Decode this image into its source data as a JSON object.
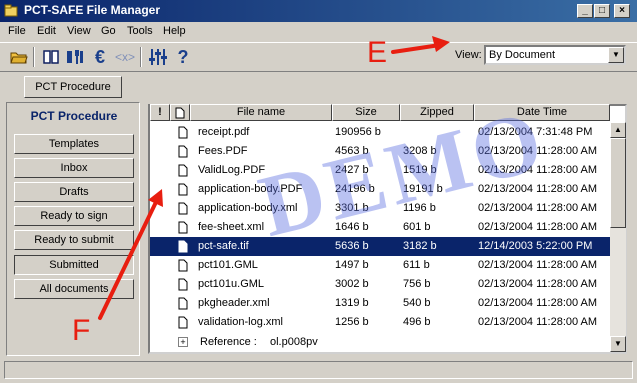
{
  "window": {
    "title": "PCT-SAFE File Manager"
  },
  "window_buttons": {
    "minimize": "_",
    "maximize": "□",
    "close": "×"
  },
  "menu": [
    "File",
    "Edit",
    "View",
    "Go",
    "Tools",
    "Help"
  ],
  "toolbar": {
    "icons": [
      "open-folder-icon",
      "book-icon",
      "tools-icon",
      "euro-icon",
      "clear-x-icon",
      "settings-sliders-icon",
      "help-icon"
    ],
    "glyphs": {
      "open": "📂",
      "book": "📖",
      "tools": "⚒",
      "euro": "€",
      "clear": "<x>",
      "sliders": "╫",
      "help": "?"
    }
  },
  "view": {
    "label": "View:",
    "selected": "By Document"
  },
  "tab": {
    "label": "PCT Procedure"
  },
  "panel": {
    "header": "PCT Procedure",
    "buttons": [
      "Templates",
      "Inbox",
      "Drafts",
      "Ready to sign",
      "Ready to submit",
      "Submitted",
      "All documents"
    ],
    "active": "Submitted"
  },
  "table": {
    "columns": [
      "!",
      "",
      "File name",
      "Size",
      "Zipped",
      "Date Time"
    ],
    "rows": [
      {
        "name": "receipt.pdf",
        "size": "190956 b",
        "zipped": "",
        "datetime": "02/13/2004 7:31:48 PM"
      },
      {
        "name": "Fees.PDF",
        "size": "4563 b",
        "zipped": "3208 b",
        "datetime": "02/13/2004 11:28:00 AM"
      },
      {
        "name": "ValidLog.PDF",
        "size": "2427 b",
        "zipped": "1519 b",
        "datetime": "02/13/2004 11:28:00 AM"
      },
      {
        "name": "application-body.PDF",
        "size": "24196 b",
        "zipped": "19191 b",
        "datetime": "02/13/2004 11:28:00 AM"
      },
      {
        "name": "application-body.xml",
        "size": "3301 b",
        "zipped": "1196 b",
        "datetime": "02/13/2004 11:28:00 AM"
      },
      {
        "name": "fee-sheet.xml",
        "size": "1646 b",
        "zipped": "601 b",
        "datetime": "02/13/2004 11:28:00 AM"
      },
      {
        "name": "pct-safe.tif",
        "size": "5636 b",
        "zipped": "3182 b",
        "datetime": "12/14/2003 5:22:00 PM",
        "selected": true
      },
      {
        "name": "pct101.GML",
        "size": "1497 b",
        "zipped": "611 b",
        "datetime": "02/13/2004 11:28:00 AM"
      },
      {
        "name": "pct101u.GML",
        "size": "3002 b",
        "zipped": "756 b",
        "datetime": "02/13/2004 11:28:00 AM"
      },
      {
        "name": "pkgheader.xml",
        "size": "1319 b",
        "zipped": "540 b",
        "datetime": "02/13/2004 11:28:00 AM"
      },
      {
        "name": "validation-log.xml",
        "size": "1256 b",
        "zipped": "496 b",
        "datetime": "02/13/2004 11:28:00 AM"
      }
    ],
    "reference": {
      "expander": "+",
      "label": "Reference :",
      "value": "ol.p008pv"
    }
  },
  "watermark": "DEMO",
  "annotations": {
    "e": "E",
    "f": "F",
    "color": "#e81e10"
  },
  "colors": {
    "selection": "#0a246a",
    "title_start": "#0a246a",
    "title_end": "#3a6ea5",
    "panel_header": "#0a246a"
  }
}
